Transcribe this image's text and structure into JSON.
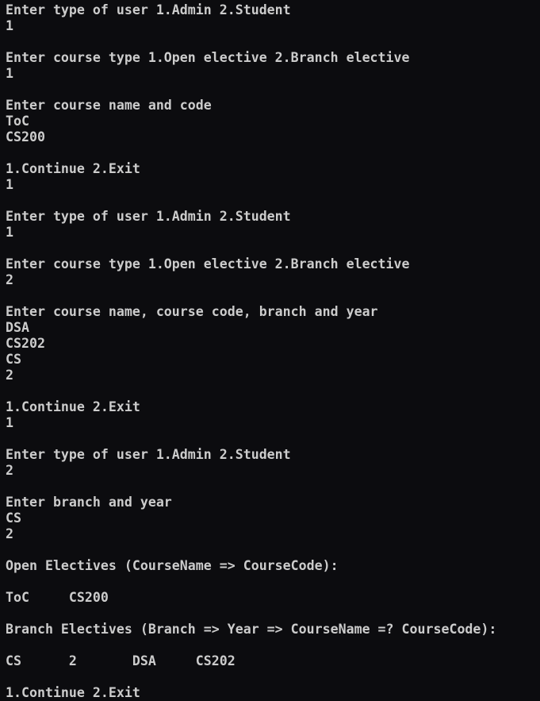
{
  "terminal": {
    "lines": [
      "Enter type of user 1.Admin 2.Student",
      "1",
      "",
      "Enter course type 1.Open elective 2.Branch elective",
      "1",
      "",
      "Enter course name and code",
      "ToC",
      "CS200",
      "",
      "1.Continue 2.Exit",
      "1",
      "",
      "Enter type of user 1.Admin 2.Student",
      "1",
      "",
      "Enter course type 1.Open elective 2.Branch elective",
      "2",
      "",
      "Enter course name, course code, branch and year",
      "DSA",
      "CS202",
      "CS",
      "2",
      "",
      "1.Continue 2.Exit",
      "1",
      "",
      "Enter type of user 1.Admin 2.Student",
      "2",
      "",
      "Enter branch and year",
      "CS",
      "2",
      "",
      "Open Electives (CourseName => CourseCode):",
      "",
      "ToC     CS200",
      "",
      "Branch Electives (Branch => Year => CourseName =? CourseCode):",
      "",
      "CS      2       DSA     CS202",
      "",
      "1.Continue 2.Exit"
    ]
  }
}
